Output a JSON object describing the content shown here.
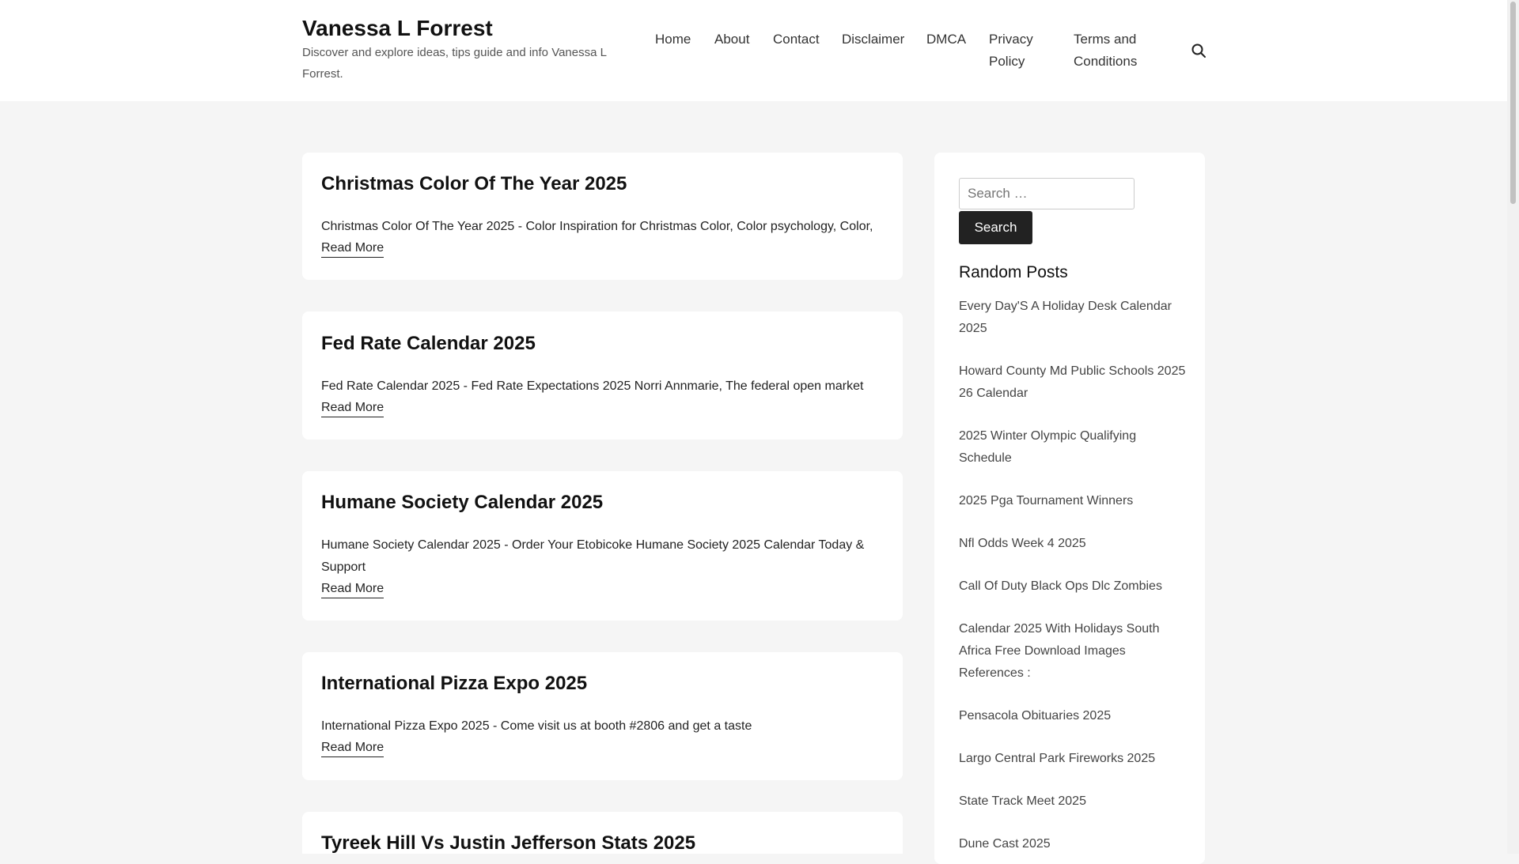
{
  "site": {
    "title": "Vanessa L Forrest",
    "description": "Discover and explore ideas, tips guide and info Vanessa L Forrest."
  },
  "nav": {
    "items": [
      {
        "label": "Home"
      },
      {
        "label": "About"
      },
      {
        "label": "Contact"
      },
      {
        "label": "Disclaimer"
      },
      {
        "label": "DMCA"
      },
      {
        "label": "Privacy Policy"
      },
      {
        "label": "Terms and Conditions"
      }
    ],
    "search_icon": "search-icon"
  },
  "posts": [
    {
      "title": "Christmas Color Of The Year 2025",
      "excerpt": "Christmas Color Of The Year 2025 - Color Inspiration for Christmas Color, Color psychology, Color,",
      "read_more": "Read More"
    },
    {
      "title": "Fed Rate Calendar 2025",
      "excerpt": "Fed Rate Calendar 2025 - Fed Rate Expectations 2025 Norri Annmarie, The federal open market",
      "read_more": "Read More"
    },
    {
      "title": "Humane Society Calendar 2025",
      "excerpt": "Humane Society Calendar 2025 - Order Your Etobicoke Humane Society 2025 Calendar Today & Support",
      "read_more": "Read More"
    },
    {
      "title": "International Pizza Expo 2025",
      "excerpt": "International Pizza Expo 2025 - Come visit us at booth #2806 and get a taste",
      "read_more": "Read More"
    },
    {
      "title": "Tyreek Hill Vs Justin Jefferson Stats 2025"
    }
  ],
  "sidebar": {
    "search_placeholder": "Search …",
    "search_button": "Search",
    "widget_title": "Random Posts",
    "random_posts": [
      "Every Day'S A Holiday Desk Calendar 2025",
      "Howard County Md Public Schools 2025 26 Calendar",
      "2025 Winter Olympic Qualifying Schedule",
      "2025 Pga Tournament Winners",
      "Nfl Odds Week 4 2025",
      "Call Of Duty Black Ops Dlc Zombies",
      "Calendar 2025 With Holidays South Africa Free Download Images References :",
      "Pensacola Obituaries 2025",
      "Largo Central Park Fireworks 2025",
      "State Track Meet 2025",
      "Dune Cast 2025"
    ]
  }
}
